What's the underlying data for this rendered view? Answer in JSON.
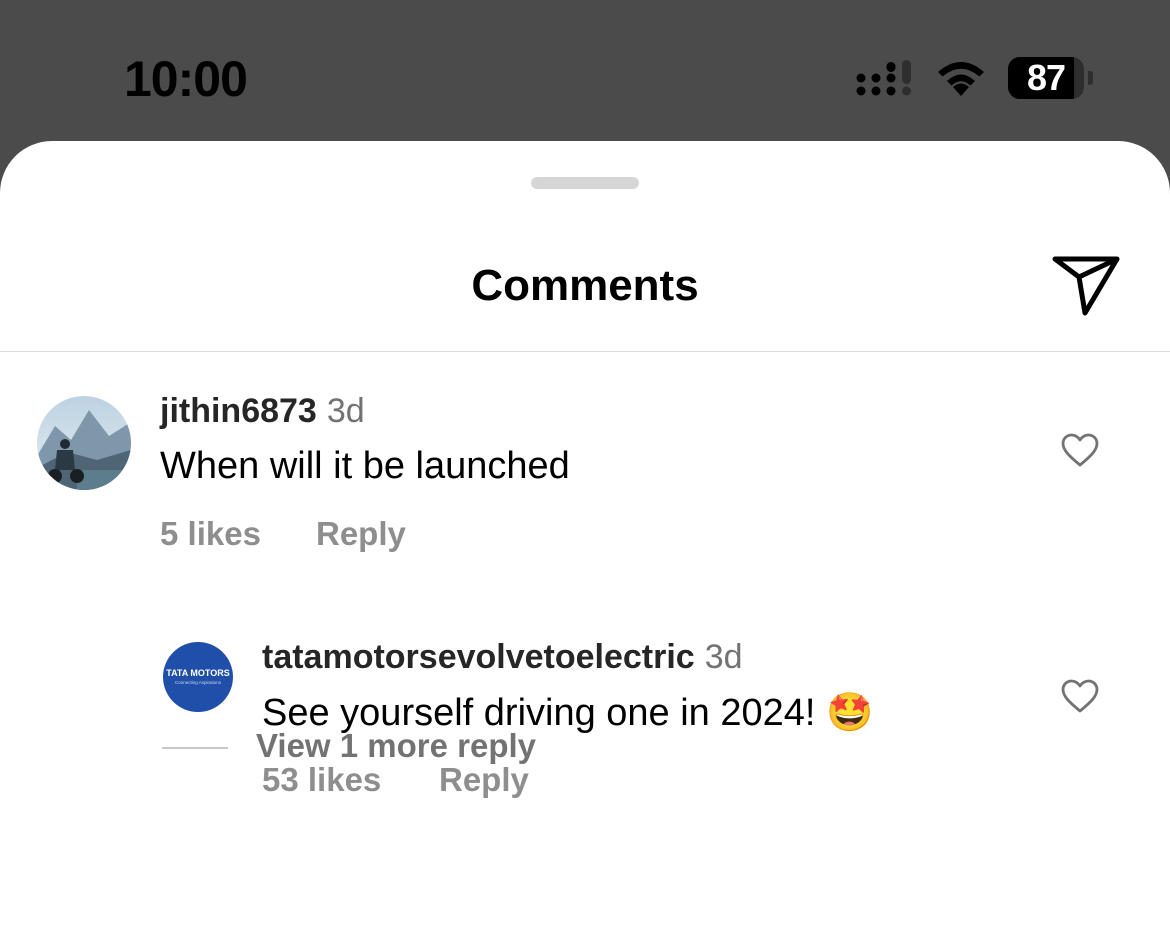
{
  "status_bar": {
    "time": "10:00",
    "battery_level": "87",
    "icons": [
      "signal-icon",
      "wifi-icon",
      "battery-icon"
    ]
  },
  "sheet": {
    "title": "Comments",
    "share_icon": "send-icon"
  },
  "comments": [
    {
      "username": "jithin6873",
      "time": "3d",
      "text": "When will it be launched",
      "likes": "5 likes",
      "reply_label": "Reply",
      "like_icon": "heart-icon"
    },
    {
      "username": "tatamotorsevolvetoelectric",
      "time": "3d",
      "text": "See yourself driving one in 2024! 🤩",
      "likes": "53 likes",
      "reply_label": "Reply",
      "like_icon": "heart-icon",
      "avatar_text": "TATA MOTORS",
      "avatar_subtext": "Connecting Aspirations"
    }
  ],
  "view_more": "View 1 more reply",
  "colors": {
    "status_bar_bg": "#4b4b4b",
    "sheet_bg": "#ffffff",
    "muted_text": "#8e8e8e",
    "tata_blue": "#1f4fa8"
  }
}
